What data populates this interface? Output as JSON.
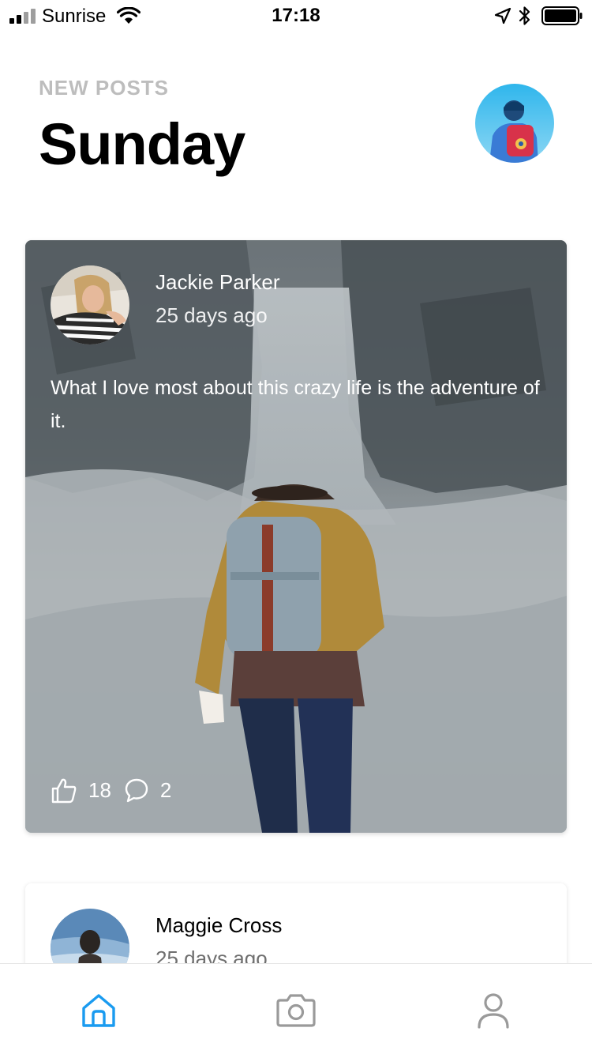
{
  "status_bar": {
    "carrier": "Sunrise",
    "time": "17:18"
  },
  "header": {
    "kicker": "NEW POSTS",
    "title": "Sunday"
  },
  "posts": [
    {
      "author": "Jackie Parker",
      "time": "25 days ago",
      "text": "What I love most about this crazy life is the adventure of it.",
      "likes": "18",
      "comments": "2"
    },
    {
      "author": "Maggie Cross",
      "time": "25 days ago"
    }
  ],
  "tabs": [
    {
      "icon": "home-icon",
      "active": true
    },
    {
      "icon": "camera-icon",
      "active": false
    },
    {
      "icon": "user-icon",
      "active": false
    }
  ],
  "colors": {
    "accent": "#1a9bf0",
    "inactive_icon": "#9a9a9a",
    "kicker": "#bdbdbd"
  }
}
